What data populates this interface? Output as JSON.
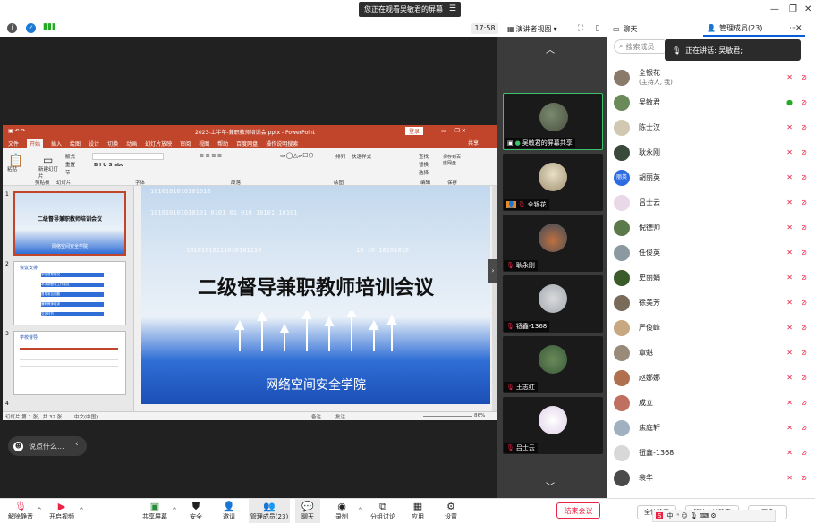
{
  "banner": {
    "text": "您正在观看吴敏君的屏幕"
  },
  "toolbar_top": {
    "time": "17:58",
    "view_label": "演讲者视图"
  },
  "tabs": {
    "chat": "聊天",
    "members": "管理成员(23)"
  },
  "ppt": {
    "title": "2023-上半年-兼职教师培训会.pptx - PowerPoint",
    "login": "登录",
    "share": "共享",
    "tabs": [
      "文件",
      "开始",
      "插入",
      "绘图",
      "设计",
      "切换",
      "动画",
      "幻灯片放映",
      "审阅",
      "视图",
      "帮助",
      "百度网盘",
      "操作说明搜索"
    ],
    "ribbon_groups": [
      "剪贴板",
      "幻灯片",
      "字体",
      "段落",
      "绘图",
      "编辑",
      "保存"
    ],
    "ribbon_labels": [
      "粘贴",
      "新建幻灯片",
      "版式",
      "重置",
      "节",
      "查找",
      "替换",
      "选择",
      "保存到百度网盘",
      "排列",
      "快速样式"
    ],
    "slide_title": "二级督导兼职教师培训会议",
    "slide_subtitle": "网络空间安全学院",
    "bits": [
      "1010101010101010",
      "101010101010101  0101  01 010 10101 10101",
      "10101010111010101110",
      "10  10  10101010"
    ],
    "thumb1_title": "二级督导兼职教师培训会议",
    "thumb1_sub": "网络空间安全学院",
    "thumb2_heading": "会议安排",
    "thumb2_items": [
      "学校督导概况",
      "本学期督导工作要点",
      "督导常见问题",
      "兼职教师培训",
      "交流环节"
    ],
    "thumb3_heading": "学校督导",
    "thumb_numbers": [
      "1",
      "2",
      "3",
      "4"
    ],
    "status_left": "幻灯片 第 1 张，共 32 张",
    "status_lang": "中文(中国)",
    "status_notes": "备注",
    "status_comments": "批注",
    "status_zoom": "86%"
  },
  "chat": {
    "placeholder": "说点什么..."
  },
  "video_tiles": [
    {
      "name": "吴敏君的屏幕共享"
    },
    {
      "name": "全银花"
    },
    {
      "name": "耿永刚"
    },
    {
      "name": "钮鑫-1368"
    },
    {
      "name": "王志红"
    },
    {
      "name": "吕士云"
    }
  ],
  "panel": {
    "search_placeholder": "搜索成员",
    "speaking": "正在讲话: 吴敏君;",
    "members": [
      {
        "name": "全银花",
        "note": "(主持人, 我)",
        "color": "#8a7a6a"
      },
      {
        "name": "吴敏君",
        "note": "",
        "color": "#6a8a5a"
      },
      {
        "name": "陈士汉",
        "note": "",
        "color": "#d0c8b0"
      },
      {
        "name": "耿永刚",
        "note": "",
        "color": "#3a4a3a"
      },
      {
        "name": "胡丽英",
        "note": "",
        "color": "#2d6be0",
        "initials": "丽英"
      },
      {
        "name": "吕士云",
        "note": "",
        "color": "#e8d8e8"
      },
      {
        "name": "倪德帅",
        "note": "",
        "color": "#5a7a4a"
      },
      {
        "name": "任俊英",
        "note": "",
        "color": "#8a9aa0"
      },
      {
        "name": "史丽娟",
        "note": "",
        "color": "#3a5a2a"
      },
      {
        "name": "徐美芳",
        "note": "",
        "color": "#7a6a5a"
      },
      {
        "name": "严俊峰",
        "note": "",
        "color": "#c8a880"
      },
      {
        "name": "章魁",
        "note": "",
        "color": "#9a8a7a"
      },
      {
        "name": "赵娜娜",
        "note": "",
        "color": "#b07050"
      },
      {
        "name": "成立",
        "note": "",
        "color": "#c07060"
      },
      {
        "name": "焦庭轩",
        "note": "",
        "color": "#a0b0c0"
      },
      {
        "name": "钮鑫-1368",
        "note": "",
        "color": "#d8d8d8"
      },
      {
        "name": "裴华",
        "note": "",
        "color": "#4a4a4a"
      }
    ],
    "footer_buttons": [
      "全体静音",
      "解除全体静音",
      "更多"
    ]
  },
  "toolbar": {
    "items": [
      "解除静音",
      "开启视频",
      "共享屏幕",
      "安全",
      "邀请",
      "管理成员(23)",
      "聊天",
      "录制",
      "分组讨论",
      "应用",
      "设置"
    ],
    "end": "结束会议"
  },
  "ime": {
    "label": "中"
  }
}
